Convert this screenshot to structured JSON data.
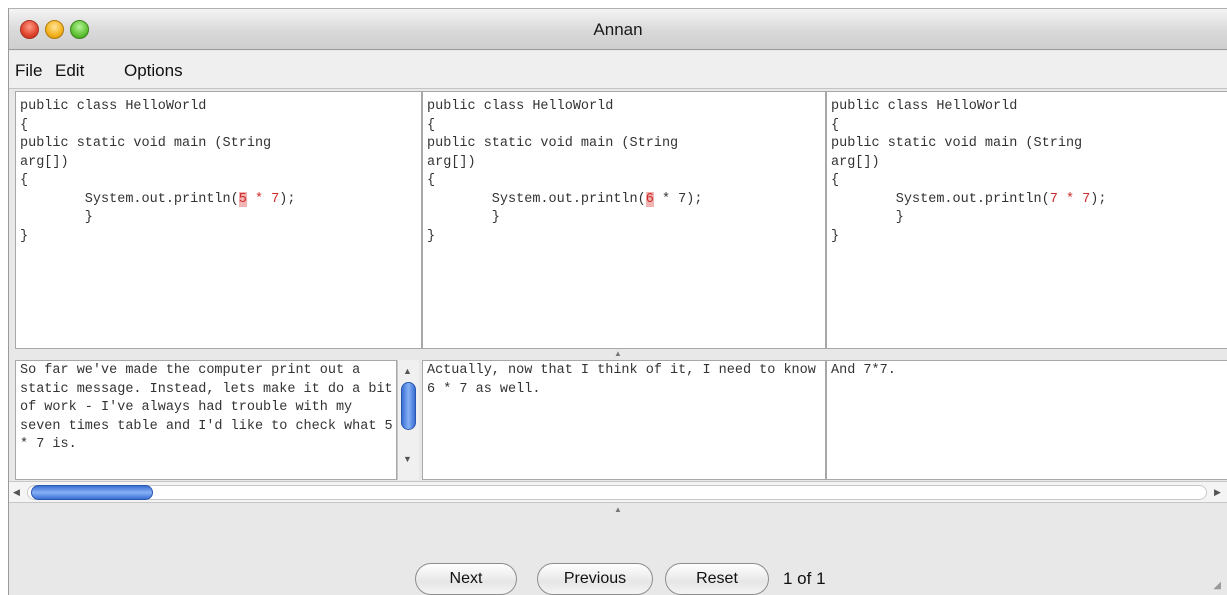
{
  "window": {
    "title": "Annan"
  },
  "menu": [
    "File",
    "Edit",
    "Options"
  ],
  "code_panes": [
    {
      "line1": "public class HelloWorld",
      "line2": "{",
      "line3": "public static void main (String",
      "line4": "arg[])",
      "line5": "{",
      "print_prefix": "        System.out.println(",
      "num": "5",
      "operator": " * 7",
      "print_suffix": ");",
      "line7": "        }",
      "line8": "}"
    },
    {
      "line1": "public class HelloWorld",
      "line2": "{",
      "line3": "public static void main (String",
      "line4": "arg[])",
      "line5": "{",
      "print_prefix": "        System.out.println(",
      "num": "6",
      "operator": " * 7",
      "print_suffix": ");",
      "line7": "        }",
      "line8": "}"
    },
    {
      "line1": "public class HelloWorld",
      "line2": "{",
      "line3": "public static void main (String",
      "line4": "arg[])",
      "line5": "{",
      "print_prefix": "        System.out.println(",
      "num": "7",
      "operator": " * 7",
      "print_suffix": ");",
      "line7": "        }",
      "line8": "}"
    }
  ],
  "descriptions": [
    "So far we've made the computer print out a static message. Instead, lets make it do a bit of work - I've always had trouble with my seven times table and I'd like to check what 5 * 7 is.",
    "Actually, now that I think of it, I need to know 6 * 7 as well.",
    "And 7*7."
  ],
  "buttons": {
    "next": "Next",
    "previous": "Previous",
    "reset": "Reset"
  },
  "page_indicator": "1 of 1",
  "icons": {
    "close": "close-button-icon",
    "minimize": "minimize-button-icon",
    "zoom": "zoom-button-icon",
    "up": "▲",
    "down": "▼",
    "left": "◀",
    "right": "▶",
    "split": "▲",
    "grip": "◢"
  },
  "colors": {
    "highlight": "#cc2b2b",
    "scroll_thumb": "#3b6fd4"
  }
}
